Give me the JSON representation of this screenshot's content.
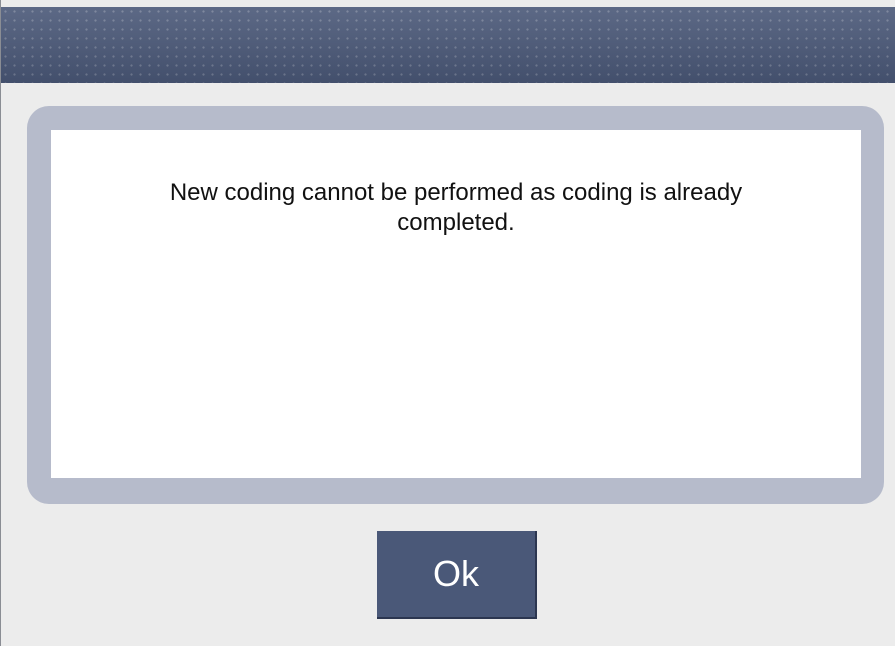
{
  "dialog": {
    "message": "New coding cannot be performed as coding is already completed.",
    "ok_label": "Ok"
  },
  "colors": {
    "titlebar": "#4a5878",
    "frame": "#b6bbcb",
    "button": "#4a5878",
    "background": "#ececec"
  }
}
